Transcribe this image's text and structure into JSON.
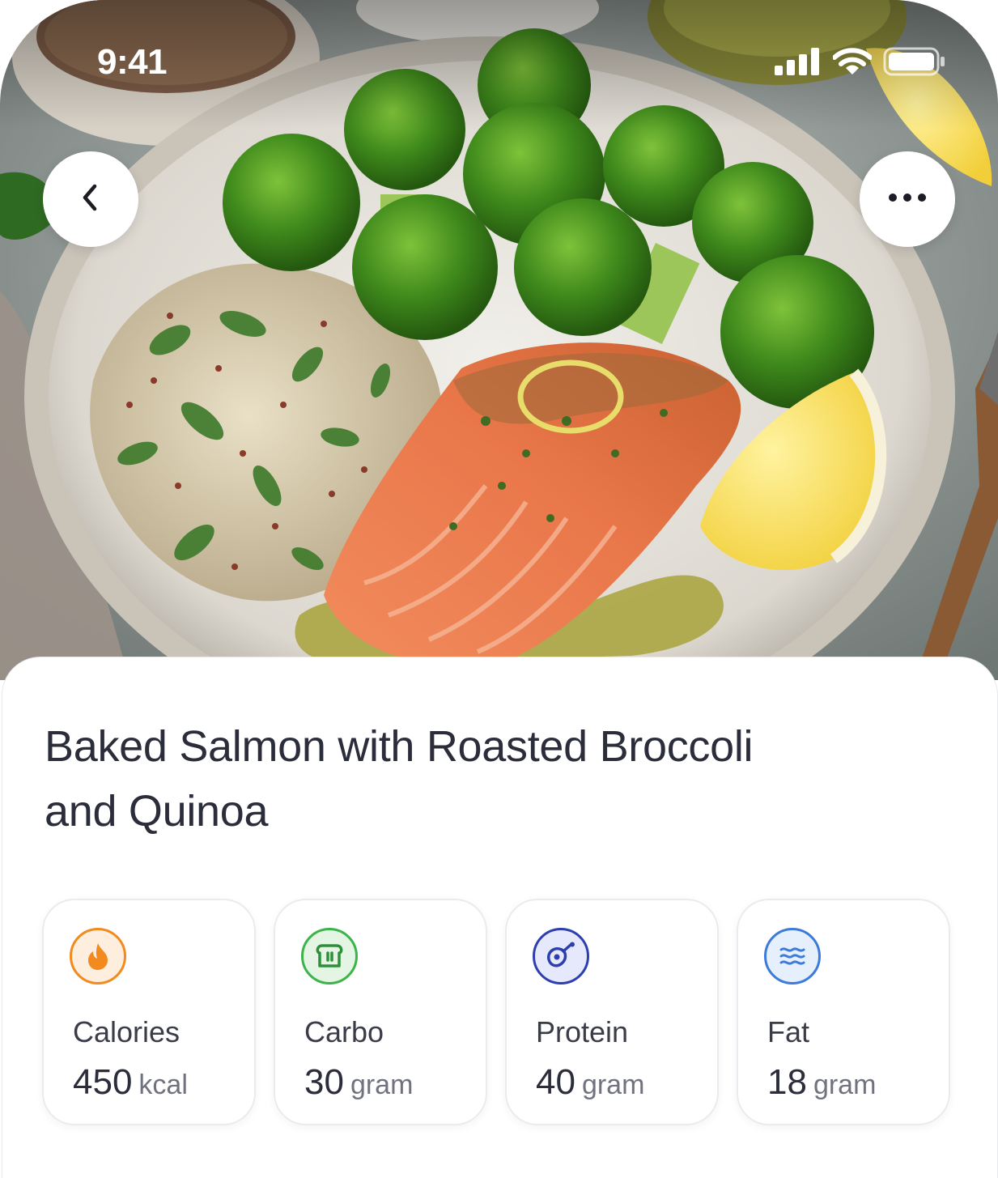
{
  "status_bar": {
    "time": "9:41"
  },
  "header": {
    "back_icon": "chevron-left-icon",
    "more_icon": "more-horizontal-icon"
  },
  "recipe": {
    "title": "Baked Salmon with Roasted Broccoli and Quinoa"
  },
  "nutrition": [
    {
      "label": "Calories",
      "value": "450",
      "unit": "kcal",
      "icon": "flame-icon",
      "color": "#F28A1F"
    },
    {
      "label": "Carbo",
      "value": "30",
      "unit": "gram",
      "icon": "bread-icon",
      "color": "#3BB54A"
    },
    {
      "label": "Protein",
      "value": "40",
      "unit": "gram",
      "icon": "meat-icon",
      "color": "#2D3FB0"
    },
    {
      "label": "Fat",
      "value": "18",
      "unit": "gram",
      "icon": "waves-icon",
      "color": "#3C7BD9"
    }
  ]
}
